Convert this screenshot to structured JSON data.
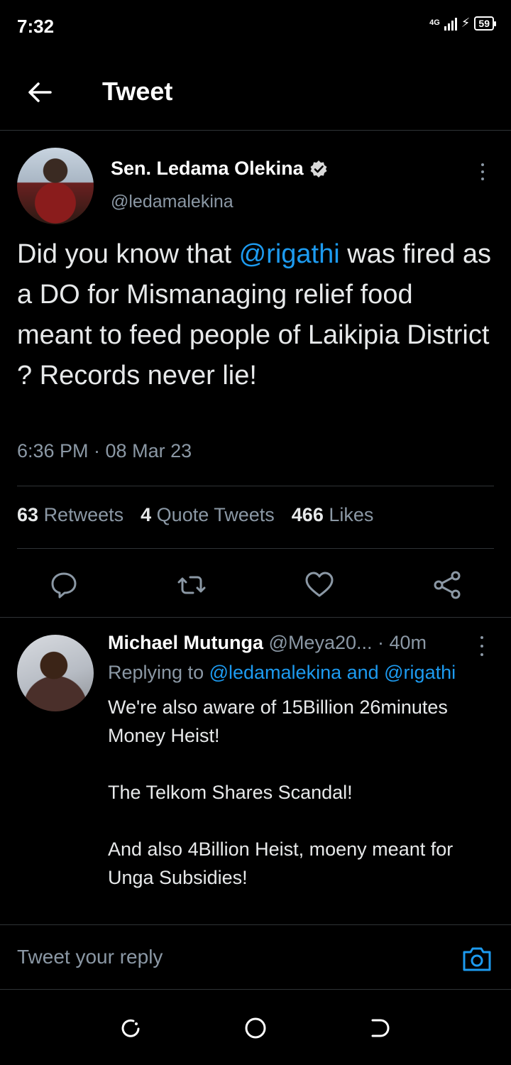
{
  "status_bar": {
    "time": "7:32",
    "network": "4G",
    "battery": "59"
  },
  "header": {
    "title": "Tweet"
  },
  "tweet": {
    "author_name": "Sen. Ledama Olekina",
    "author_handle": "@ledamalekina",
    "text_before": "Did you know that ",
    "mention": "@rigathi",
    "text_after": " was fired as a DO for Mismanaging relief food meant to feed people of Laikipia District ?  Records never lie!",
    "timestamp": "6:36 PM · 08 Mar 23",
    "stats": {
      "retweets_count": "63",
      "retweets_label": "Retweets",
      "quotes_count": "4",
      "quotes_label": "Quote Tweets",
      "likes_count": "466",
      "likes_label": "Likes"
    }
  },
  "reply": {
    "author_name": "Michael Mutunga",
    "author_handle": "@Meya20...",
    "age": " · 40m",
    "replying_prefix": "Replying to ",
    "replying_targets": "@ledamalekina and @rigathi",
    "paragraphs": [
      "We're also aware of 15Billion 26minutes Money Heist!",
      "The Telkom Shares Scandal!",
      "And also 4Billion Heist, moeny meant for Unga Subsidies!"
    ]
  },
  "composer": {
    "placeholder": "Tweet your reply"
  },
  "colors": {
    "background": "#000000",
    "link": "#1d9bf0",
    "secondary_text": "#8b98a5",
    "divider": "#2f3336"
  }
}
